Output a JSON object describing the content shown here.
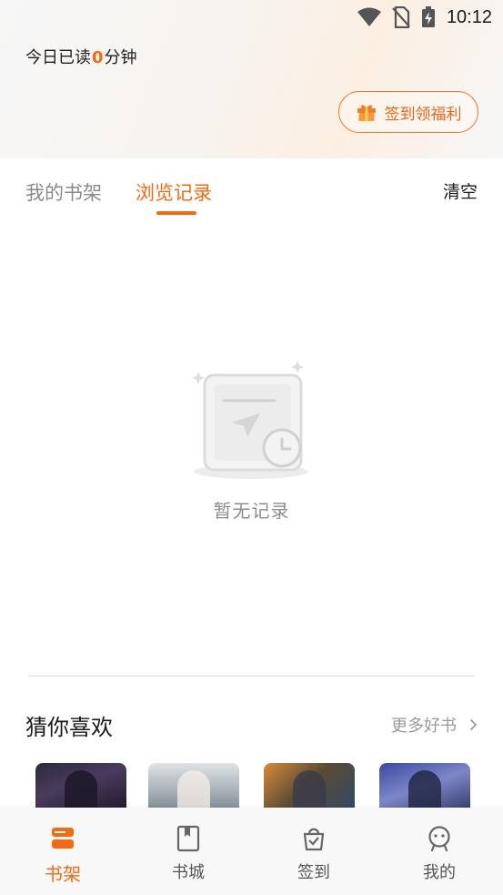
{
  "status_bar": {
    "time": "10:12"
  },
  "header": {
    "reading_prefix": "今日已读",
    "reading_minutes": "0",
    "reading_suffix": "分钟",
    "sign_in_label": "签到领福利"
  },
  "tabs": [
    {
      "label": "我的书架",
      "active": false
    },
    {
      "label": "浏览记录",
      "active": true
    }
  ],
  "clear_label": "清空",
  "empty_state": {
    "text": "暂无记录"
  },
  "recommend": {
    "title": "猜你喜欢",
    "more_label": "更多好书"
  },
  "bottom_nav": [
    {
      "label": "书架",
      "icon": "bookshelf-icon",
      "active": true
    },
    {
      "label": "书城",
      "icon": "book-icon",
      "active": false
    },
    {
      "label": "签到",
      "icon": "checkin-bag-icon",
      "active": false
    },
    {
      "label": "我的",
      "icon": "profile-face-icon",
      "active": false
    }
  ],
  "colors": {
    "accent": "#f26b12",
    "muted": "#8a8a8a",
    "nav_bg": "#f8f8f8"
  }
}
